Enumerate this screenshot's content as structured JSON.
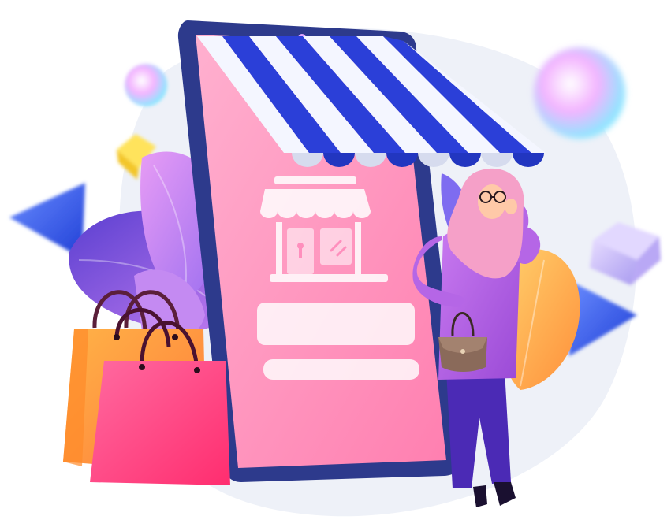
{
  "illustration": {
    "subject": "online-shop-illustration",
    "colors": {
      "phone_frame": "#2d3a8c",
      "screen_top": "#ff9ec4",
      "screen_bottom": "#ff7fb0",
      "awning_blue": "#2b3fd8",
      "awning_white": "#f4f6ff",
      "bag_orange": "#ff9a3c",
      "bag_pink": "#ff4d8d",
      "hijab": "#f5a0c8",
      "tunic": "#b25ce0",
      "pants": "#4b2ab5",
      "purse": "#8a6a5a",
      "triangle_blue": "#2f5bff",
      "leaf_purple": "#7b4fe0",
      "leaf_orange": "#ffa640"
    }
  }
}
